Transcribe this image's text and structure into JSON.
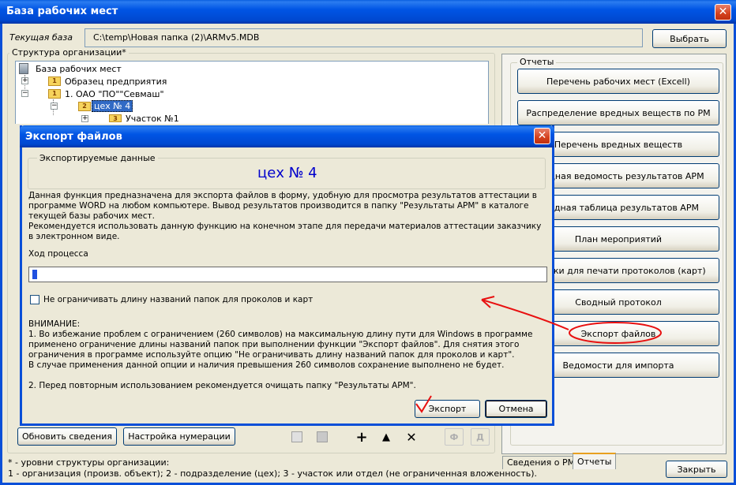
{
  "main_window": {
    "title": "База рабочих мест",
    "close_glyph": "✕",
    "current_base_label": "Текущая база",
    "current_base_path": "C:\\temp\\Новая папка (2)\\ARMv5.MDB",
    "select_button": "Выбрать",
    "structure_label": "Структура организации*",
    "tree": {
      "root": "База рабочих мест",
      "items": [
        {
          "badge": "1",
          "label": "Образец предприятия"
        },
        {
          "badge": "1",
          "label": "1. ОАО \"ПО\"\"Севмаш\""
        },
        {
          "badge": "2",
          "label": "цех № 4"
        },
        {
          "badge": "3",
          "label": "Участок №1"
        }
      ],
      "expand_plus": "+",
      "expand_minus": "−"
    },
    "bottom_buttons": {
      "refresh": "Обновить сведения",
      "numbering": "Настройка нумерации"
    },
    "toolbar": {
      "add": "+",
      "up": "▲",
      "delete": "✕",
      "f": "Ф",
      "d": "Д"
    },
    "reports_label": "Отчеты",
    "reports": [
      "Перечень рабочих мест (Excell)",
      "Распределение вредных веществ по РМ",
      "Перечень вредных веществ",
      "Сводная ведомость результатов АРМ",
      "Сводная таблица результатов АРМ",
      "План мероприятий",
      "Бланки для печати протоколов (карт)",
      "Сводный протокол",
      "Экспорт файлов",
      "Ведомости для импорта"
    ],
    "tabs": {
      "info": "Сведения о РМ",
      "reports": "Отчеты"
    },
    "close_button": "Закрыть",
    "footnote_line1": "* - уровни структуры организации:",
    "footnote_line2": "1 - организация (произв. объект); 2 - подразделение (цех); 3 - участок или отдел (не ограниченная вложенность)."
  },
  "dialog": {
    "title": "Экспорт файлов",
    "close_glyph": "✕",
    "exported_label": "Экспортируемые данные",
    "exported_name": "цех № 4",
    "description": "Данная функция предназначена для экспорта файлов в форму, удобную для просмотра результатов аттестации в программе WORD на любом компьютере. Вывод результатов производится в папку \"Результаты АРМ\" в каталоге текущей базы рабочих мест.",
    "recommendation": "Рекомендуется использовать данную функцию на конечном этапе для передачи материалов аттестации заказчику в электронном  виде.",
    "progress_label": "Ход процесса",
    "progress": 0.01,
    "checkbox_label": "Не ограничивать длину названий папок для проколов и карт",
    "checkbox_checked": false,
    "warning_title": "ВНИМАНИЕ:",
    "warning_1": "1. Во избежание проблем с ограничением (260 символов) на максимальную длину пути для Windows  в программе применено ограничение длины названий папок при  выполнении функции \"Экспорт файлов\". Для снятия этого ограничения в программе используйте опцию \"Не ограничивать длину названий папок для проколов и карт\".",
    "warning_1b": "В случае применения данной опции  и наличия превышения 260 символов сохранение выполнено не будет.",
    "warning_2": "2. Перед повторным использованием рекомендуется очищать папку \"Результаты АРМ\".",
    "export_button": "Экспорт",
    "cancel_button": "Отмена"
  },
  "colors": {
    "annotation_red": "#e81010",
    "dialog_accent_text": "#0000cc",
    "selected_tree_bg": "#316ac5"
  }
}
